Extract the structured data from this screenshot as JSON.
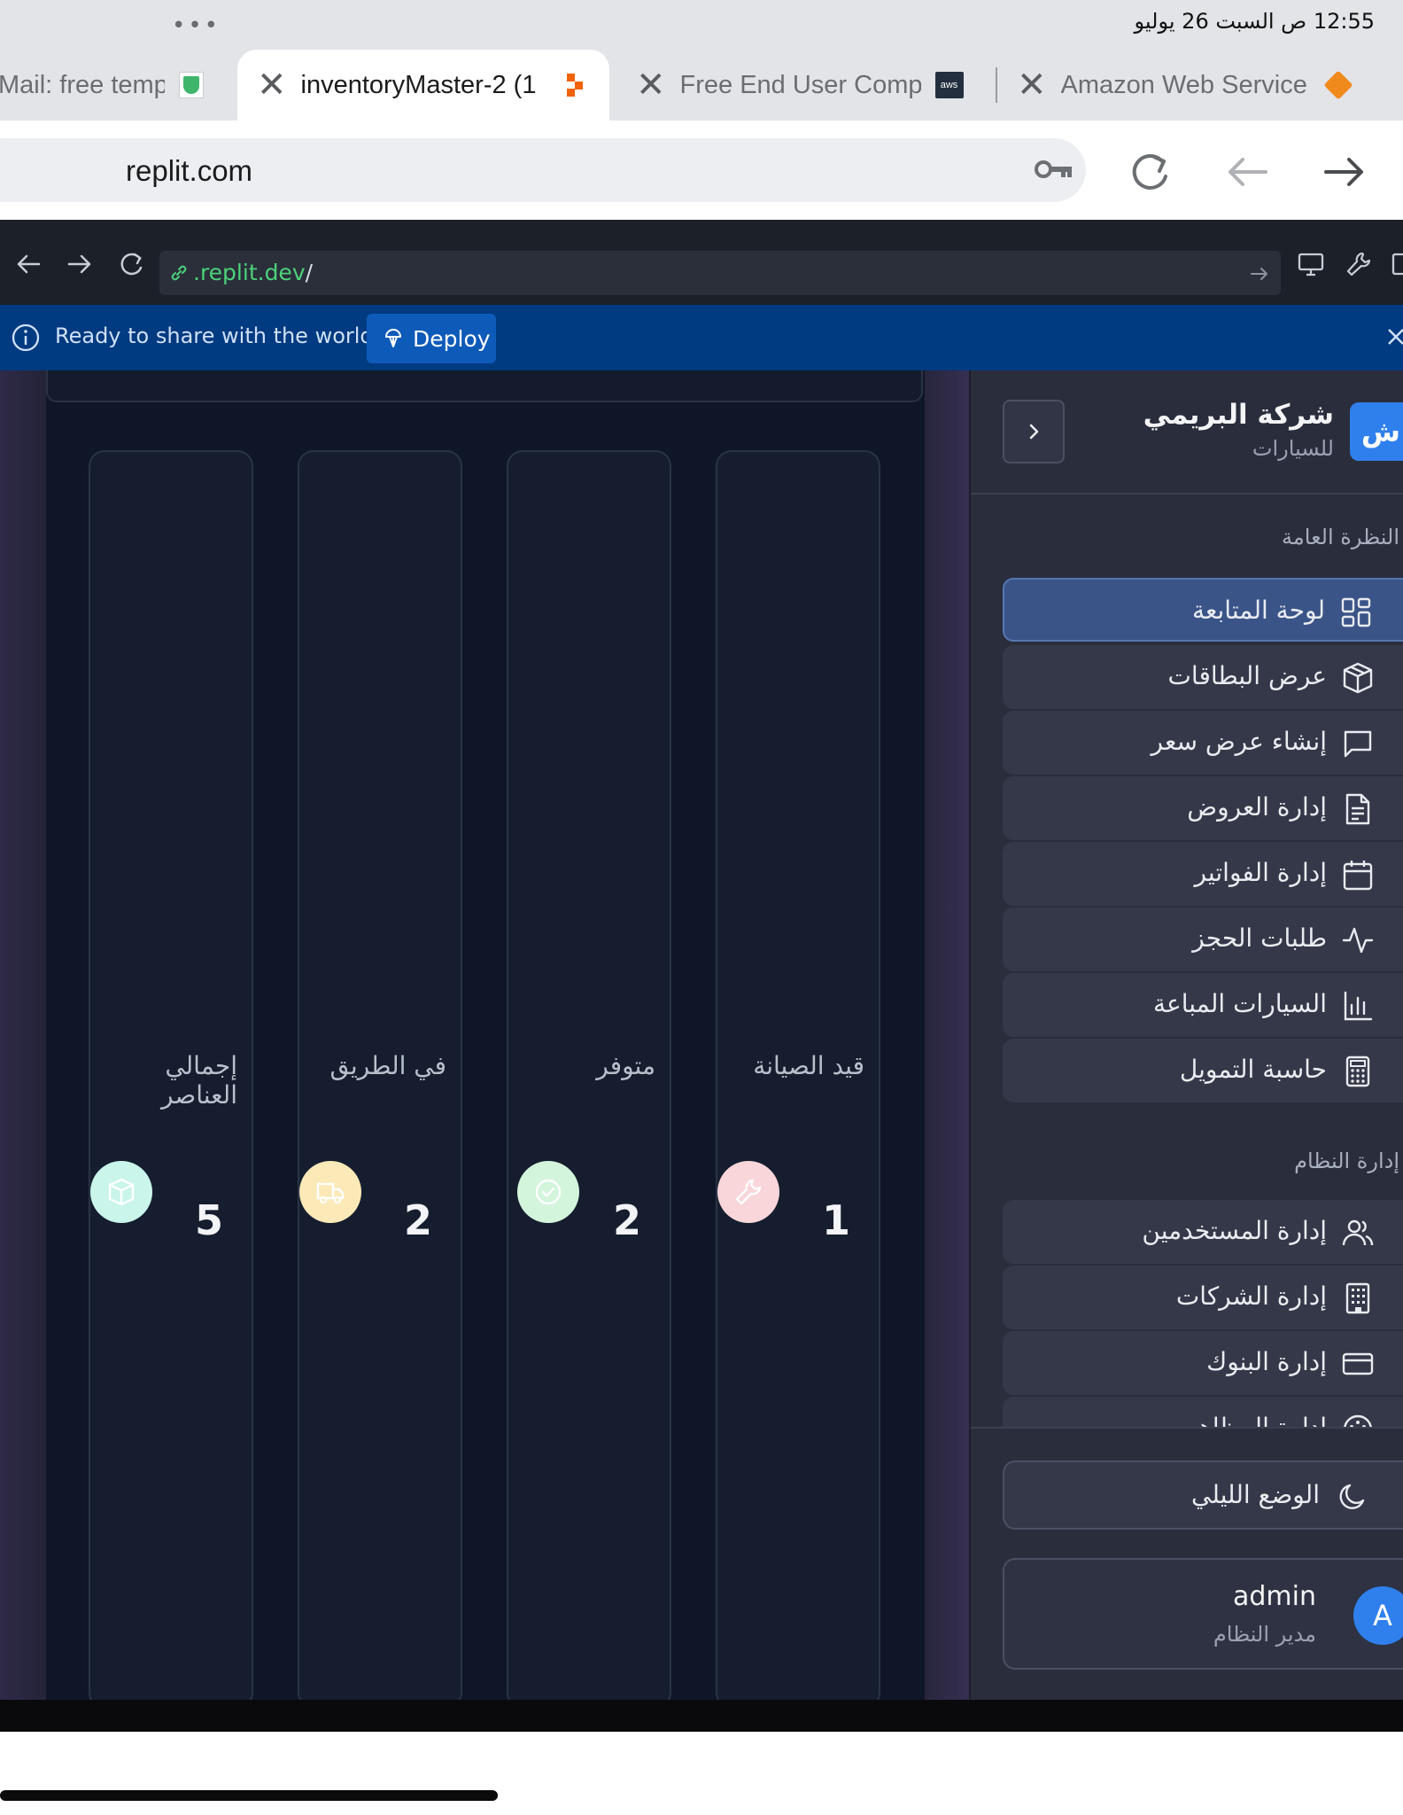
{
  "status_bar": {
    "dots": "•••",
    "time_date": "12:55 ص   السبت 26 يوليو"
  },
  "browser": {
    "tabs": [
      {
        "title": "Mail: free temp",
        "favicon": "shield-icon"
      },
      {
        "title": "inventoryMaster-2 (1",
        "favicon": "replit-icon"
      },
      {
        "title": "Free End User Comp",
        "favicon": "aws-icon"
      },
      {
        "title": "Amazon Web Service",
        "favicon": "cube-icon"
      }
    ],
    "close_glyph": "✕",
    "address": "replit.com",
    "aws_badge": "aws"
  },
  "replit": {
    "url_host": ".replit.dev",
    "url_path": "/",
    "banner_text": "Ready to share with the world?",
    "deploy_label": "Deploy"
  },
  "stats": [
    {
      "label": "إجمالي العناصر",
      "value": "5",
      "icon": "package-icon",
      "color": "#c9f5ea"
    },
    {
      "label": "في الطريق",
      "value": "2",
      "icon": "truck-icon",
      "color": "#fbe9b7"
    },
    {
      "label": "متوفر",
      "value": "2",
      "icon": "check-circle-icon",
      "color": "#d3f5dc"
    },
    {
      "label": "قيد الصيانة",
      "value": "1",
      "icon": "wrench-icon",
      "color": "#f9d6da"
    }
  ],
  "sidebar": {
    "logo_letter": "ش",
    "company_name": "شركة البريمي",
    "company_sub": "للسيارات",
    "section_overview": "النظرة العامة",
    "overview_items": [
      {
        "label": "لوحة المتابعة",
        "icon": "grid-icon",
        "active": true
      },
      {
        "label": "عرض البطاقات",
        "icon": "box-icon"
      },
      {
        "label": "إنشاء عرض سعر",
        "icon": "message-square-icon"
      },
      {
        "label": "إدارة العروض",
        "icon": "file-text-icon"
      },
      {
        "label": "إدارة الفواتير",
        "icon": "calendar-icon"
      },
      {
        "label": "طلبات الحجز",
        "icon": "activity-icon"
      },
      {
        "label": "السيارات المباعة",
        "icon": "bar-chart-icon"
      },
      {
        "label": "حاسبة التمويل",
        "icon": "calculator-icon"
      }
    ],
    "section_system": "إدارة النظام",
    "system_items": [
      {
        "label": "إدارة المستخدمين",
        "icon": "users-icon"
      },
      {
        "label": "إدارة الشركات",
        "icon": "building-icon"
      },
      {
        "label": "إدارة البنوك",
        "icon": "credit-card-icon"
      },
      {
        "label": "إدارة المظاهر",
        "icon": "palette-icon"
      }
    ],
    "dark_mode_label": "الوضع الليلي",
    "user": {
      "avatar_letter": "A",
      "name": "admin",
      "role": "مدير النظام"
    }
  }
}
